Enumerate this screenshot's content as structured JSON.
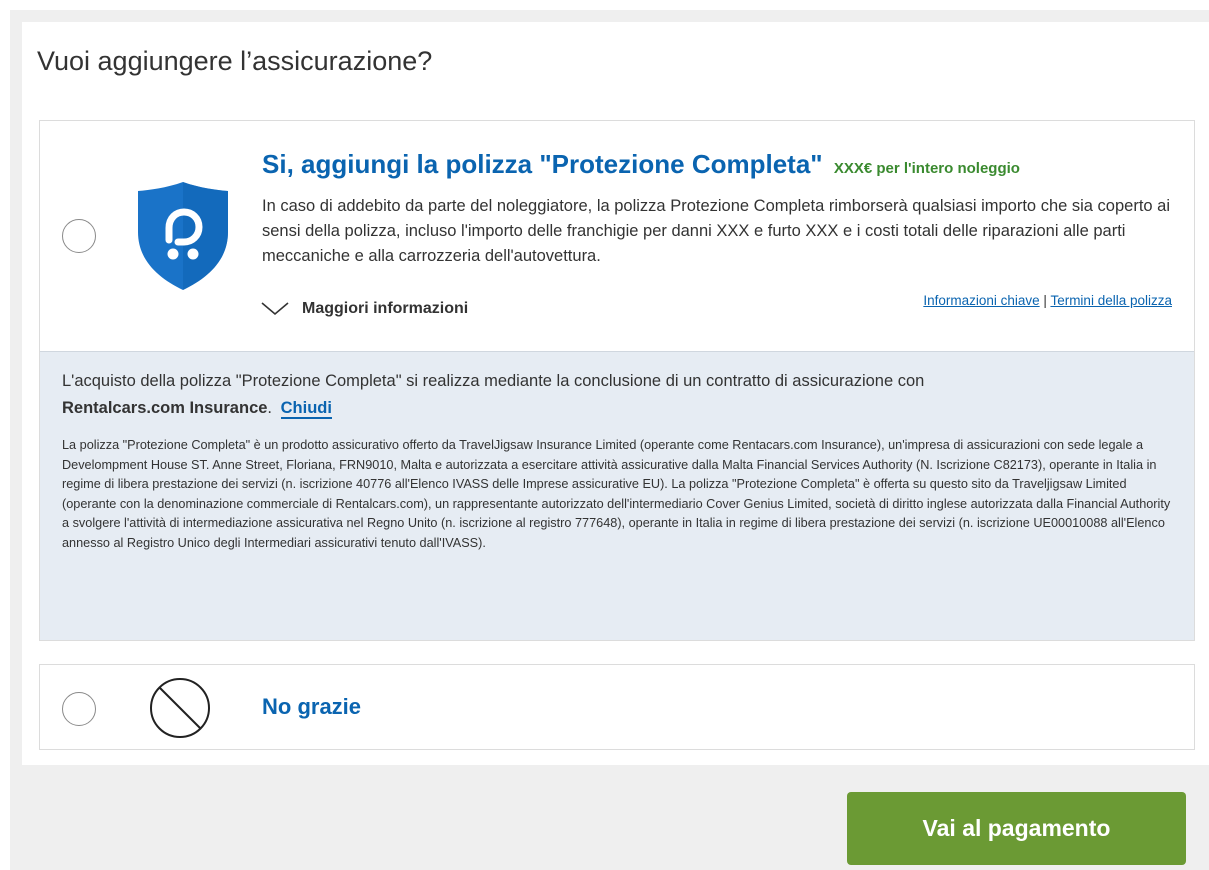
{
  "heading": "Vuoi aggiungere l’assicurazione?",
  "option_full": {
    "title": "Si, aggiungi la polizza \"Protezione Completa\"",
    "price": "XXX€ per l'intero noleggio",
    "description": "In caso di addebito da parte del noleggiatore, la polizza Protezione Completa rimborserà qualsiasi importo che sia coperto ai sensi della polizza, incluso l'importo delle franchigie per danni XXX e furto XXX e i costi totali delle riparazioni alle parti meccaniche e alla carrozzeria dell'autovettura.",
    "more_info": "Maggiori informazioni",
    "link_key_info": "Informazioni chiave",
    "link_separator": "|",
    "link_terms": "Termini della polizza",
    "shield_icon": "shield-icon",
    "shield_color": "#1a73c8"
  },
  "info_box": {
    "lead_text": "L'acquisto della polizza \"Protezione Completa\" si realizza mediante la conclusione di un contratto di assicurazione con",
    "insurer": "Rentalcars.com Insurance",
    "period": ".",
    "close_label": "Chiudi",
    "legal_text": "La polizza \"Protezione Completa\" è un prodotto assicurativo offerto da TravelJigsaw Insurance Limited (operante come Rentacars.com Insurance), un'impresa di assicurazioni con sede legale a Develompment House ST. Anne Street, Floriana, FRN9010, Malta e autorizzata a esercitare attività assicurative dalla Malta Financial Services Authority (N. Iscrizione C82173), operante in Italia in regime di libera prestazione dei servizi (n. iscrizione 40776 all'Elenco IVASS delle Imprese assicurative EU). La polizza \"Protezione Completa\" è offerta su questo sito da Traveljigsaw Limited (operante con la denominazione commerciale di Rentalcars.com), un rappresentante autorizzato dell'intermediario Cover Genius Limited, società di diritto inglese autorizzata dalla Financial Authority a svolgere l'attività di intermediazione assicurativa nel Regno Unito (n. iscrizione al registro 777648), operante in Italia in regime di libera prestazione dei servizi (n. iscrizione UE00010088 all'Elenco annesso al Registro Unico degli Intermediari assicurativi tenuto dall'IVASS)."
  },
  "option_none": {
    "label": "No grazie",
    "icon": "no-entry-icon"
  },
  "pay_button": "Vai al pagamento",
  "colors": {
    "link_blue": "#0a64b0",
    "price_green": "#3a8a2f",
    "button_green": "#6b9a34",
    "info_bg": "#e6ecf3"
  }
}
